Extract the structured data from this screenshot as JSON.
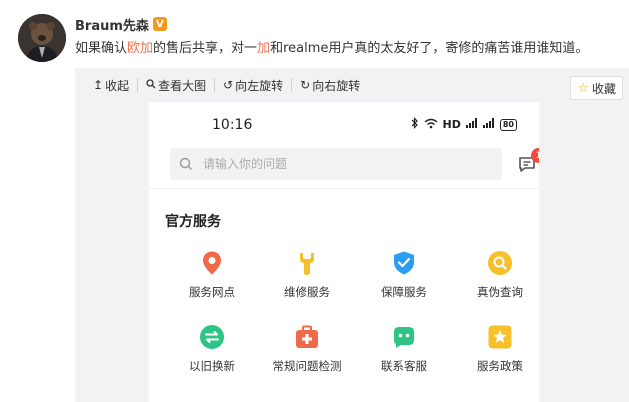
{
  "post": {
    "username": "Braum先森",
    "verified_badge": "V",
    "text_before": "如果确认",
    "text_highlight_1": "欧加",
    "text_middle_1": "的售后共享，对一",
    "text_highlight_2": "加",
    "text_after": "和realme用户真的太友好了，寄修的痛苦谁用谁知道。"
  },
  "viewer": {
    "toolbar": {
      "collapse_label": "收起",
      "view_large_label": "查看大图",
      "rotate_left_label": "向左旋转",
      "rotate_right_label": "向右旋转"
    },
    "favorite_label": "收藏"
  },
  "phone": {
    "status_bar": {
      "time": "10:16",
      "network": "HD",
      "battery": "80"
    },
    "search": {
      "placeholder": "请输入你的问题"
    },
    "message_badge_count": "1",
    "section_title": "官方服务",
    "services": [
      {
        "label": "服务网点",
        "icon": "location-pin-icon",
        "color": "#f06a4a"
      },
      {
        "label": "维修服务",
        "icon": "wrench-icon",
        "color": "#f5c02a"
      },
      {
        "label": "保障服务",
        "icon": "shield-check-icon",
        "color": "#2a9df4"
      },
      {
        "label": "真伪查询",
        "icon": "magnifier-icon",
        "color": "#f5c02a"
      },
      {
        "label": "以旧换新",
        "icon": "exchange-arrows-icon",
        "color": "#2fc486"
      },
      {
        "label": "常规问题检测",
        "icon": "medical-kit-icon",
        "color": "#f06a4a"
      },
      {
        "label": "联系客服",
        "icon": "chat-face-icon",
        "color": "#2fc486"
      },
      {
        "label": "服务政策",
        "icon": "star-badge-icon",
        "color": "#f5c02a"
      }
    ]
  }
}
